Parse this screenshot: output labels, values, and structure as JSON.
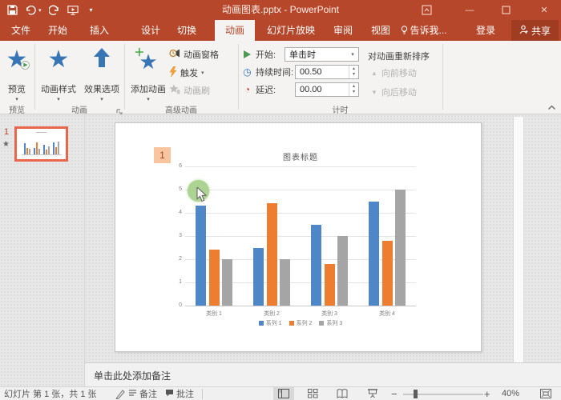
{
  "colors": {
    "accent": "#B7472A",
    "chart_blue": "#4E86C8",
    "chart_orange": "#ED7D31",
    "chart_gray": "#A5A5A5"
  },
  "titlebar": {
    "title": "动画图表.pptx - PowerPoint"
  },
  "tabs": {
    "file": "文件",
    "home": "开始",
    "insert": "插入",
    "design": "设计",
    "transitions": "切换",
    "animations": "动画",
    "slideshow": "幻灯片放映",
    "review": "审阅",
    "view": "视图",
    "tellme": "告诉我...",
    "signin": "登录",
    "share": "共享"
  },
  "ribbon": {
    "preview": {
      "button": "预览",
      "group": "预览"
    },
    "animation": {
      "styles": "动画样式",
      "effect_options": "效果选项",
      "group": "动画"
    },
    "advanced": {
      "add_animation": "添加动画",
      "animation_pane": "动画窗格",
      "trigger": "触发",
      "animation_painter": "动画刷",
      "group": "高级动画"
    },
    "timing": {
      "start_label": "开始:",
      "start_value": "单击时",
      "duration_label": "持续时间:",
      "duration_value": "00.50",
      "delay_label": "延迟:",
      "delay_value": "00.00",
      "reorder_title": "对动画重新排序",
      "move_earlier": "向前移动",
      "move_later": "向后移动",
      "group": "计时"
    }
  },
  "slide_panel": {
    "slide_number": "1"
  },
  "slide": {
    "animation_badge": "1"
  },
  "chart_data": {
    "type": "bar",
    "title": "图表标题",
    "categories": [
      "类别 1",
      "类别 2",
      "类别 3",
      "类别 4"
    ],
    "series": [
      {
        "name": "系列 1",
        "color": "#4E86C8",
        "values": [
          4.3,
          2.5,
          3.5,
          4.5
        ]
      },
      {
        "name": "系列 2",
        "color": "#ED7D31",
        "values": [
          2.4,
          4.4,
          1.8,
          2.8
        ]
      },
      {
        "name": "系列 3",
        "color": "#A5A5A5",
        "values": [
          2.0,
          2.0,
          3.0,
          5.0
        ]
      }
    ],
    "ylim": [
      0,
      6
    ],
    "yticks": [
      0,
      1,
      2,
      3,
      4,
      5,
      6
    ],
    "grid": true,
    "legend_position": "bottom"
  },
  "notes": {
    "placeholder": "单击此处添加备注"
  },
  "statusbar": {
    "slide_info": "幻灯片 第 1 张，共 1 张",
    "notes": "备注",
    "comments": "批注",
    "zoom_level": "40%"
  }
}
